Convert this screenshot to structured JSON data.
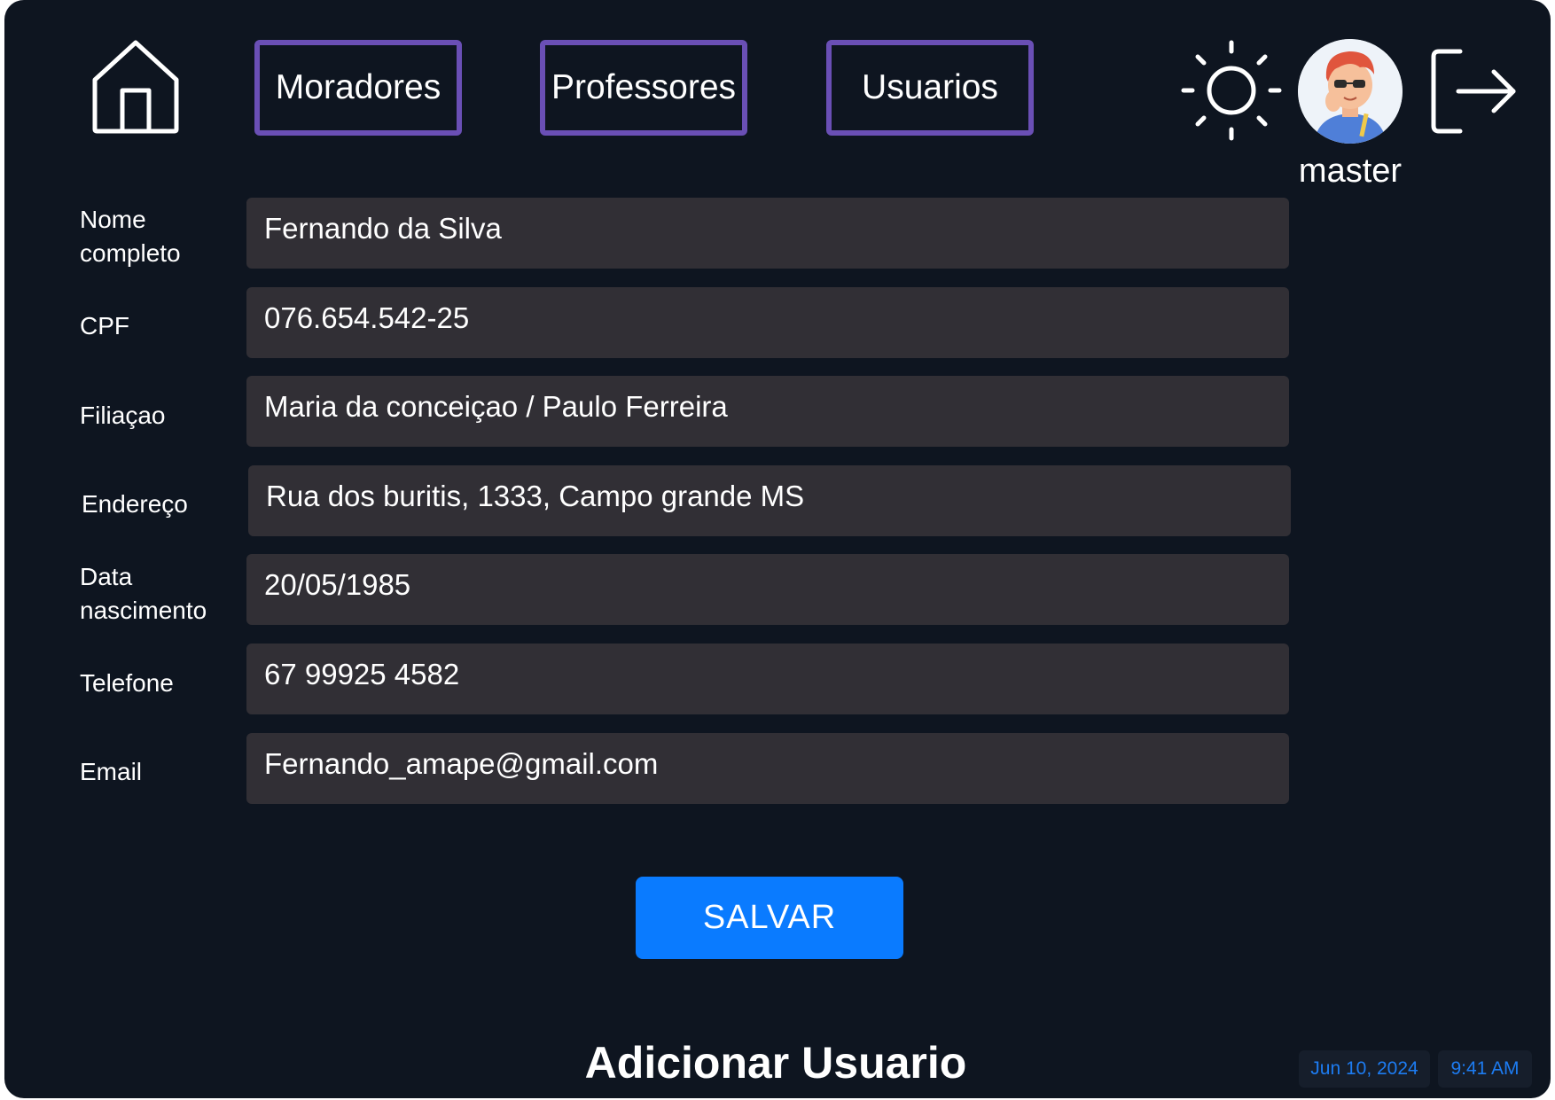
{
  "header": {
    "tabs": [
      {
        "label": "Moradores"
      },
      {
        "label": "Professores"
      },
      {
        "label": "Usuarios"
      }
    ],
    "user": {
      "name": "master"
    },
    "icons": {
      "home": "home-icon",
      "theme": "sun-icon",
      "logout": "logout-icon"
    }
  },
  "form": {
    "fields": [
      {
        "label": "Nome\ncompleto",
        "value": "Fernando da Silva"
      },
      {
        "label": "CPF",
        "value": "076.654.542-25"
      },
      {
        "label": "Filiaçao",
        "value": "Maria da conceiçao / Paulo Ferreira"
      },
      {
        "label": "Endereço",
        "value": "Rua dos buritis, 1333, Campo grande MS"
      },
      {
        "label": "Data\nnascimento",
        "value": "20/05/1985"
      },
      {
        "label": "Telefone",
        "value": "67 99925 4582"
      },
      {
        "label": "Email",
        "value": "Fernando_amape@gmail.com"
      }
    ],
    "save_label": "SALVAR"
  },
  "page": {
    "title": "Adicionar Usuario",
    "date": "Jun 10, 2024",
    "time": "9:41 AM"
  },
  "colors": {
    "background": "#0e1520",
    "tab_border": "#6a4fb5",
    "input_bg": "#312f35",
    "primary": "#0a7bff"
  }
}
